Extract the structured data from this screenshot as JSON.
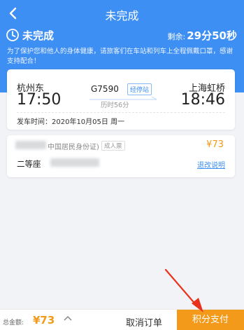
{
  "nav": {
    "back_icon": "chevron-left-icon",
    "title": "未完成"
  },
  "status": {
    "icon": "clock-icon",
    "label": "未完成",
    "remain_label": "剩余:",
    "remain_time": "29分50秒",
    "notice": "为了保护您和他人的身体健康，请旅客们在车站和列车上全程佩戴口罩，感谢支持配合！"
  },
  "trip": {
    "from_station": "杭州东",
    "from_time": "17:50",
    "to_station": "上海虹桥",
    "to_time": "18:46",
    "train_no": "G7590",
    "stops_button": "经停站",
    "duration": "历时56分",
    "depart_label": "发车时间：",
    "depart_date": "2020年10月05日 周一"
  },
  "passenger": {
    "id_type": "中国居民身份证)",
    "ticket_type": "成人票",
    "price": "¥73",
    "seat_class": "二等座",
    "change_link": "退改说明"
  },
  "footer": {
    "total_label": "总金额:",
    "total_value": "¥73",
    "expand_icon": "chevron-up-icon",
    "cancel_label": "取消订单",
    "pay_label": "积分支付"
  },
  "colors": {
    "primary": "#3d8ff3",
    "accent": "#f49a1b",
    "annotation": "#e8321e"
  }
}
